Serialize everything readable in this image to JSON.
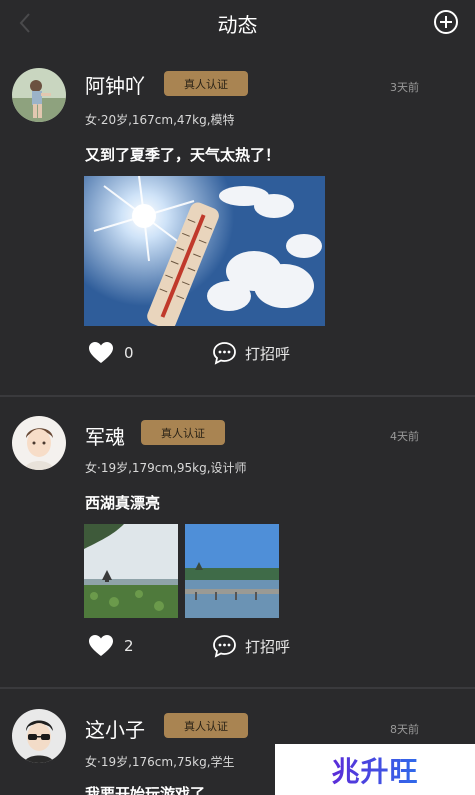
{
  "header": {
    "title": "动态"
  },
  "posts": [
    {
      "username": "阿钟吖",
      "badge": "真人认证",
      "time": "3天前",
      "meta": "女·20岁,167cm,47kg,模特",
      "text": "又到了夏季了，天气太热了！",
      "likes": "0",
      "greet": "打招呼",
      "images": [
        "thermometer-sky-photo"
      ]
    },
    {
      "username": "军魂",
      "badge": "真人认证",
      "time": "4天前",
      "meta": "女·19岁,179cm,95kg,设计师",
      "text": "西湖真漂亮",
      "likes": "2",
      "greet": "打招呼",
      "images": [
        "lotus-pavilion-photo",
        "lake-causeway-photo"
      ]
    },
    {
      "username": "这小子",
      "badge": "真人认证",
      "time": "8天前",
      "meta": "女·19岁,176cm,75kg,学生",
      "text": "我要开始玩游戏了"
    }
  ],
  "watermark": "兆升旺",
  "colors": {
    "background": "#2a2a2c",
    "badge": "#a98452",
    "divider": "#3a3a3d"
  }
}
